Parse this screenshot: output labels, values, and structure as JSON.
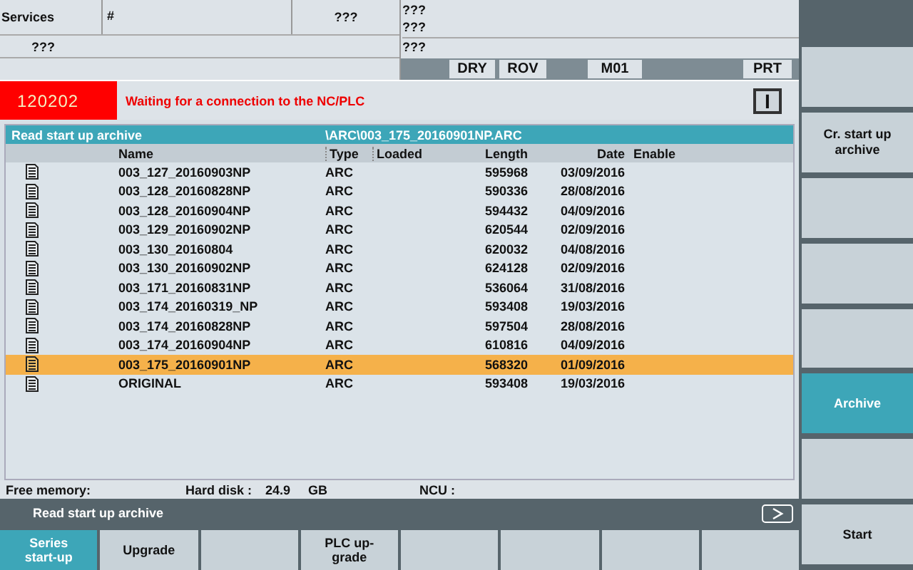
{
  "header": {
    "area": "Services",
    "program": "#",
    "channel": "???",
    "info_lines": [
      "???",
      "???",
      "???"
    ],
    "status": "???"
  },
  "flags": [
    {
      "label": "DRY"
    },
    {
      "label": "ROV"
    },
    {
      "label": "M01"
    },
    {
      "label": "PRT"
    }
  ],
  "alarm": {
    "code": "120202",
    "message": "Waiting for a connection to the NC/PLC",
    "indicator": "I"
  },
  "archive": {
    "title": "Read start up archive",
    "path": "\\ARC\\003_175_20160901NP.ARC",
    "columns": [
      "Name",
      "Type",
      "Loaded",
      "Length",
      "Date",
      "Enable"
    ],
    "rows": [
      {
        "name": "003_127_20160903NP",
        "type": "ARC",
        "length": "595968",
        "date": "03/09/2016",
        "selected": false
      },
      {
        "name": "003_128_20160828NP",
        "type": "ARC",
        "length": "590336",
        "date": "28/08/2016",
        "selected": false
      },
      {
        "name": "003_128_20160904NP",
        "type": "ARC",
        "length": "594432",
        "date": "04/09/2016",
        "selected": false
      },
      {
        "name": "003_129_20160902NP",
        "type": "ARC",
        "length": "620544",
        "date": "02/09/2016",
        "selected": false
      },
      {
        "name": "003_130_20160804",
        "type": "ARC",
        "length": "620032",
        "date": "04/08/2016",
        "selected": false
      },
      {
        "name": "003_130_20160902NP",
        "type": "ARC",
        "length": "624128",
        "date": "02/09/2016",
        "selected": false
      },
      {
        "name": "003_171_20160831NP",
        "type": "ARC",
        "length": "536064",
        "date": "31/08/2016",
        "selected": false
      },
      {
        "name": "003_174_20160319_NP",
        "type": "ARC",
        "length": "593408",
        "date": "19/03/2016",
        "selected": false
      },
      {
        "name": "003_174_20160828NP",
        "type": "ARC",
        "length": "597504",
        "date": "28/08/2016",
        "selected": false
      },
      {
        "name": "003_174_20160904NP",
        "type": "ARC",
        "length": "610816",
        "date": "04/09/2016",
        "selected": false
      },
      {
        "name": "003_175_20160901NP",
        "type": "ARC",
        "length": "568320",
        "date": "01/09/2016",
        "selected": true
      },
      {
        "name": "ORIGINAL",
        "type": "ARC",
        "length": "593408",
        "date": "19/03/2016",
        "selected": false
      }
    ]
  },
  "memory": {
    "free_label": "Free memory:",
    "disk_label": "Hard disk :",
    "disk_value": "24.9",
    "disk_unit": "GB",
    "ncu_label": "NCU :"
  },
  "status_bar": {
    "text": "Read start up archive"
  },
  "vertical_softkeys": [
    {
      "selected": false
    },
    {
      "label": "Cr. start up archive",
      "selected": false
    },
    {
      "selected": false
    },
    {
      "selected": false
    },
    {
      "selected": false
    },
    {
      "label": "Archive",
      "selected": true
    },
    {
      "selected": false
    },
    {
      "label": "Start",
      "selected": false
    }
  ],
  "horizontal_softkeys": [
    {
      "label": "Series start-up",
      "selected": true
    },
    {
      "label": "Upgrade",
      "selected": false
    },
    {
      "selected": false
    },
    {
      "label": "PLC up-grade",
      "selected": false
    },
    {
      "selected": false
    },
    {
      "selected": false
    },
    {
      "selected": false
    },
    {
      "selected": false
    }
  ]
}
